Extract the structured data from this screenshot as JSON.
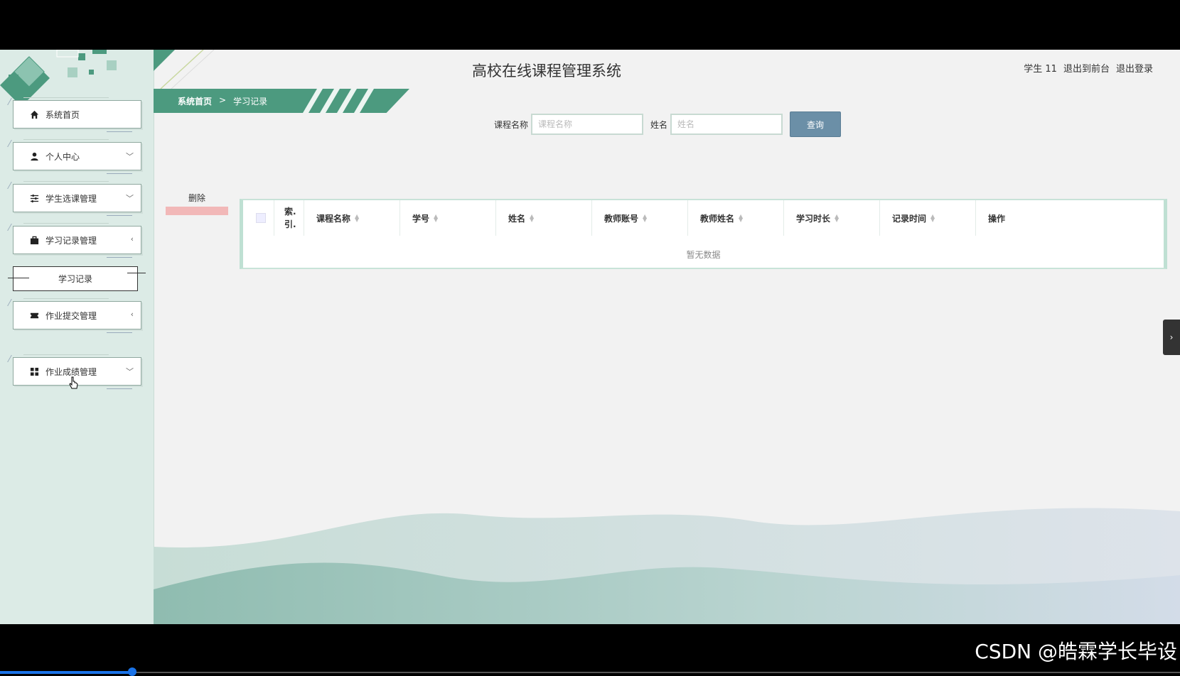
{
  "header": {
    "title": "高校在线课程管理系统",
    "user_label": "学生 11",
    "front_link": "退出到前台",
    "logout_link": "退出登录"
  },
  "breadcrumb": {
    "home": "系统首页",
    "separator": ">",
    "current": "学习记录"
  },
  "sidebar": {
    "items": [
      {
        "label": "系统首页",
        "icon": "home-icon",
        "arrow": ""
      },
      {
        "label": "个人中心",
        "icon": "user-icon",
        "arrow": "﹀"
      },
      {
        "label": "学生选课管理",
        "icon": "sliders-icon",
        "arrow": "﹀"
      },
      {
        "label": "学习记录管理",
        "icon": "briefcase-icon",
        "arrow": "‹"
      },
      {
        "label": "作业提交管理",
        "icon": "ticket-icon",
        "arrow": "‹"
      },
      {
        "label": "作业成绩管理",
        "icon": "grid-icon",
        "arrow": "﹀"
      }
    ],
    "sub_item": "学习记录"
  },
  "search": {
    "course_label": "课程名称",
    "course_placeholder": "课程名称",
    "name_label": "姓名",
    "name_placeholder": "姓名",
    "query_button": "查询"
  },
  "actions": {
    "delete": "删除"
  },
  "table": {
    "index_header": "索.\n引.",
    "columns": [
      "课程名称",
      "学号",
      "姓名",
      "教师账号",
      "教师姓名",
      "学习时长",
      "记录时间"
    ],
    "action_header": "操作",
    "empty_text": "暂无数据"
  },
  "watermark": "CSDN @皓霖学长毕设",
  "colors": {
    "accent": "#4c9a7f",
    "sidebar_bg": "#dcebe6",
    "query_button": "#6b8fa7",
    "delete_bar": "#f2b8b8"
  }
}
